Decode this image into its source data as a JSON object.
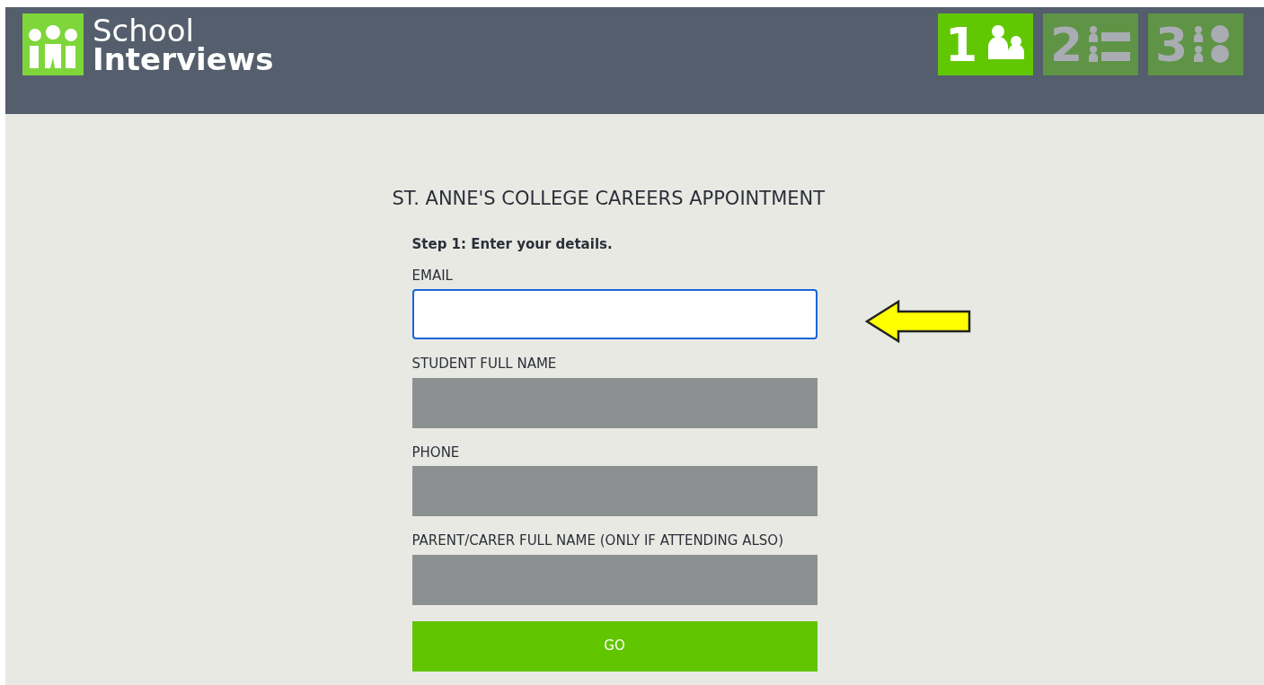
{
  "header": {
    "logo": {
      "line_1": "School",
      "line_2": "Interviews"
    },
    "steps": [
      {
        "number": "1",
        "kind": "people",
        "selected": true
      },
      {
        "number": "2",
        "kind": "list",
        "selected": false
      },
      {
        "number": "3",
        "kind": "clock",
        "selected": false
      }
    ]
  },
  "form": {
    "title": "ST. ANNE'S COLLEGE CAREERS APPOINTMENT",
    "instruction": "Step 1: Enter your details.",
    "fields": [
      {
        "label": "EMAIL",
        "focused": true,
        "disabled": false
      },
      {
        "label": "STUDENT FULL NAME",
        "focused": false,
        "disabled": true
      },
      {
        "label": "PHONE",
        "focused": false,
        "disabled": true
      },
      {
        "label": "PARENT/CARER FULL NAME (ONLY IF ATTENDING ALSO)",
        "focused": false,
        "disabled": true
      }
    ],
    "button": "GO"
  }
}
